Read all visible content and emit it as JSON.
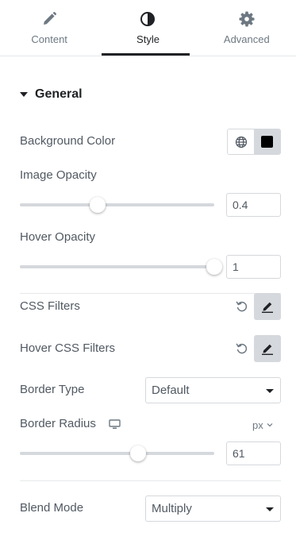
{
  "tabs": [
    {
      "label": "Content",
      "icon": "pencil-icon"
    },
    {
      "label": "Style",
      "icon": "half-circle-icon"
    },
    {
      "label": "Advanced",
      "icon": "gear-icon"
    }
  ],
  "active_tab": "Style",
  "section": {
    "title": "General",
    "expanded": true
  },
  "background_color": {
    "label": "Background Color",
    "value": "#000000"
  },
  "image_opacity": {
    "label": "Image Opacity",
    "value": "0.4",
    "level": 0.4
  },
  "hover_opacity": {
    "label": "Hover Opacity",
    "value": "1",
    "level": 1
  },
  "css_filters": {
    "label": "CSS Filters"
  },
  "hover_css_filters": {
    "label": "Hover CSS Filters"
  },
  "border_type": {
    "label": "Border Type",
    "value": "Default"
  },
  "border_radius": {
    "label": "Border Radius",
    "unit": "px",
    "value": "61",
    "level": 0.61
  },
  "blend_mode": {
    "label": "Blend Mode",
    "value": "Multiply"
  },
  "colors": {
    "accent": "#1f2124",
    "text": "#515962",
    "border": "#d5d8dc",
    "muted": "#6d7882"
  }
}
